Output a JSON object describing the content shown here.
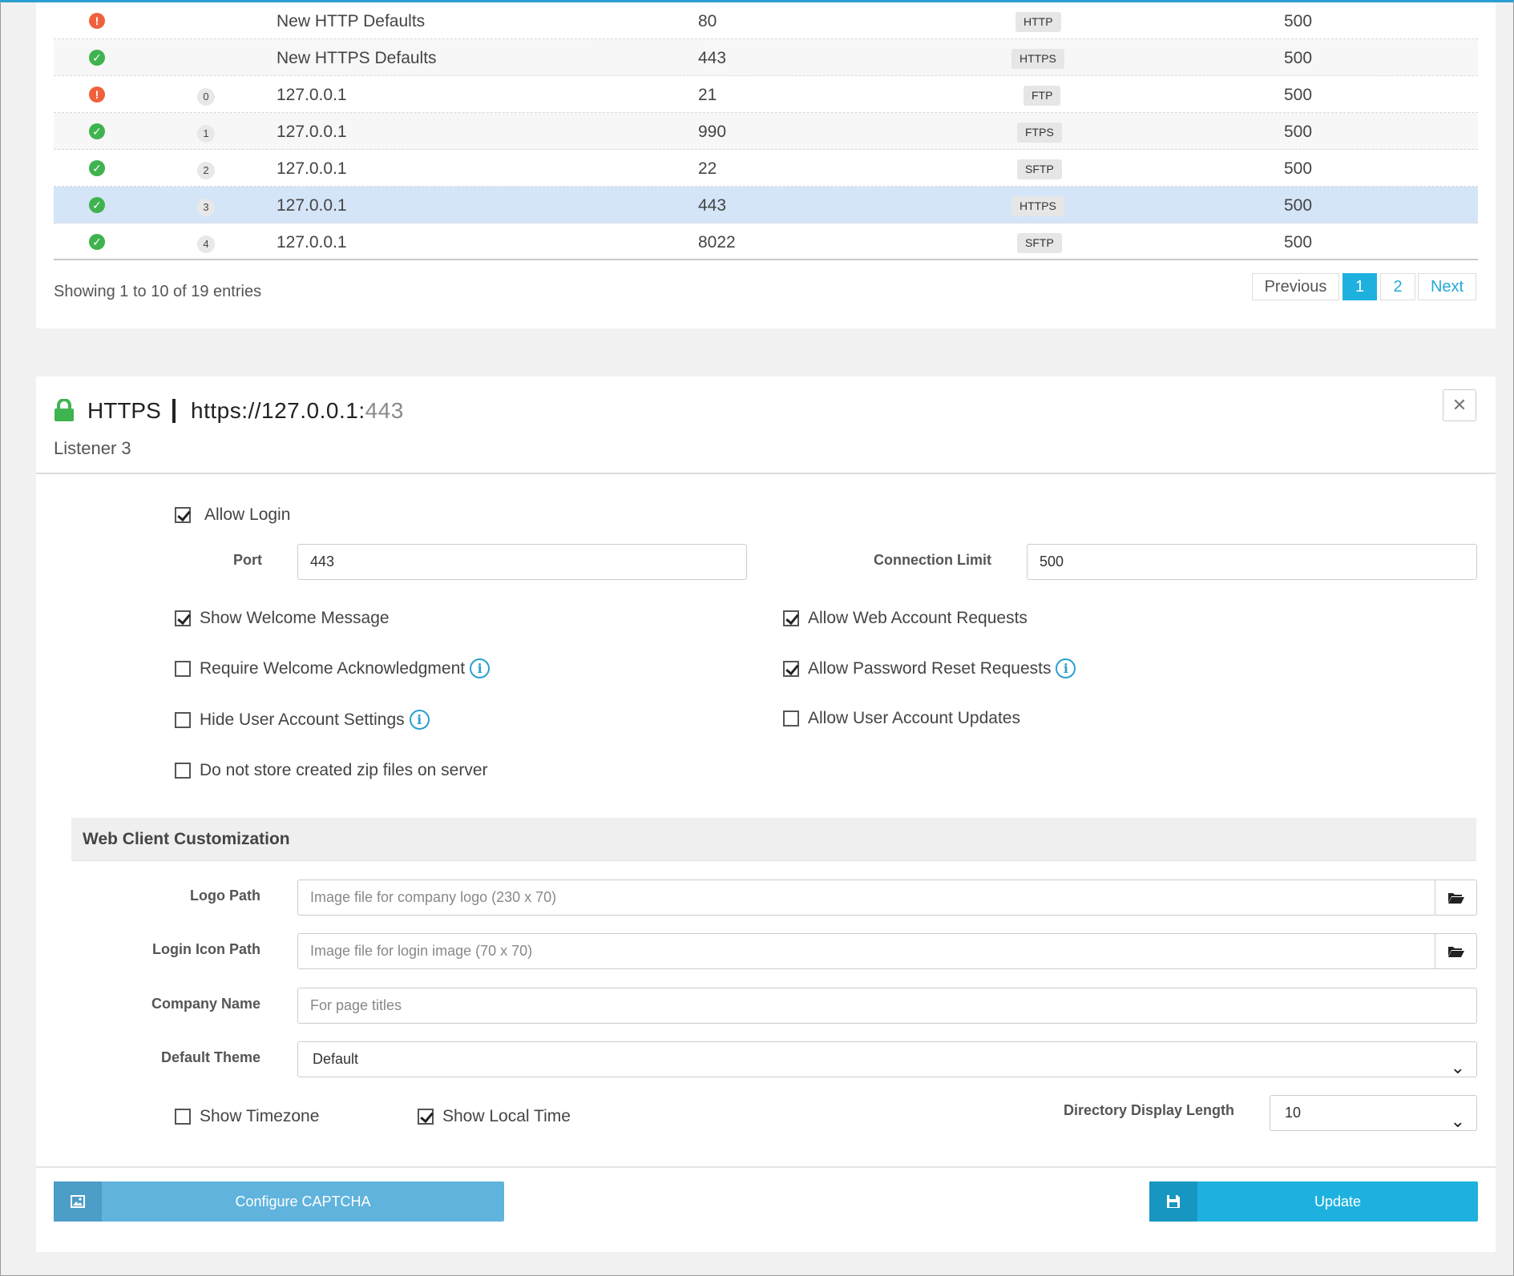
{
  "listeners": {
    "rows": [
      {
        "status": "error",
        "index": "",
        "name": "New HTTP Defaults",
        "port": "80",
        "protocol": "HTTP",
        "limit": "500"
      },
      {
        "status": "ok",
        "index": "",
        "name": "New HTTPS Defaults",
        "port": "443",
        "protocol": "HTTPS",
        "limit": "500"
      },
      {
        "status": "error",
        "index": "0",
        "name": "127.0.0.1",
        "port": "21",
        "protocol": "FTP",
        "limit": "500"
      },
      {
        "status": "ok",
        "index": "1",
        "name": "127.0.0.1",
        "port": "990",
        "protocol": "FTPS",
        "limit": "500"
      },
      {
        "status": "ok",
        "index": "2",
        "name": "127.0.0.1",
        "port": "22",
        "protocol": "SFTP",
        "limit": "500"
      },
      {
        "status": "ok",
        "index": "3",
        "name": "127.0.0.1",
        "port": "443",
        "protocol": "HTTPS",
        "limit": "500",
        "selected": true
      },
      {
        "status": "ok",
        "index": "4",
        "name": "127.0.0.1",
        "port": "8022",
        "protocol": "SFTP",
        "limit": "500"
      }
    ],
    "info": "Showing 1 to 10 of 19 entries",
    "pagination": {
      "previous": "Previous",
      "page1": "1",
      "page2": "2",
      "next": "Next",
      "active_page": 1
    }
  },
  "detail": {
    "protocol": "HTTPS",
    "url_prefix": "https://127.0.0.1:",
    "url_port": "443",
    "subtitle": "Listener 3",
    "close_icon": "close-icon",
    "allow_login": {
      "label": "Allow Login",
      "checked": true
    },
    "port": {
      "label": "Port",
      "value": "443"
    },
    "connection_limit": {
      "label": "Connection Limit",
      "value": "500"
    },
    "show_welcome": {
      "label": "Show Welcome Message",
      "checked": true
    },
    "allow_web_account": {
      "label": "Allow Web Account Requests",
      "checked": true
    },
    "require_ack": {
      "label": "Require Welcome Acknowledgment",
      "checked": false
    },
    "allow_pw_reset": {
      "label": "Allow Password Reset Requests",
      "checked": true
    },
    "hide_user_settings": {
      "label": "Hide User Account Settings",
      "checked": false
    },
    "allow_user_updates": {
      "label": "Allow User Account Updates",
      "checked": false
    },
    "no_zip": {
      "label": "Do not store created zip files on server",
      "checked": false
    },
    "web_client": {
      "heading": "Web Client Customization",
      "logo_path": {
        "label": "Logo Path",
        "placeholder": "Image file for company logo (230 x 70)"
      },
      "login_icon_path": {
        "label": "Login Icon Path",
        "placeholder": "Image file for login image (70 x 70)"
      },
      "company_name": {
        "label": "Company Name",
        "placeholder": "For page titles"
      },
      "default_theme": {
        "label": "Default Theme",
        "value": "Default"
      },
      "show_timezone": {
        "label": "Show Timezone",
        "checked": false
      },
      "show_local_time": {
        "label": "Show Local Time",
        "checked": true
      },
      "directory_display_length": {
        "label": "Directory Display Length",
        "value": "10"
      }
    },
    "buttons": {
      "captcha": "Configure CAPTCHA",
      "update": "Update"
    }
  },
  "colors": {
    "accent": "#1eb1e0",
    "ok": "#3fb34f",
    "error": "#f0603d",
    "selected_row": "#d5e5f8"
  }
}
